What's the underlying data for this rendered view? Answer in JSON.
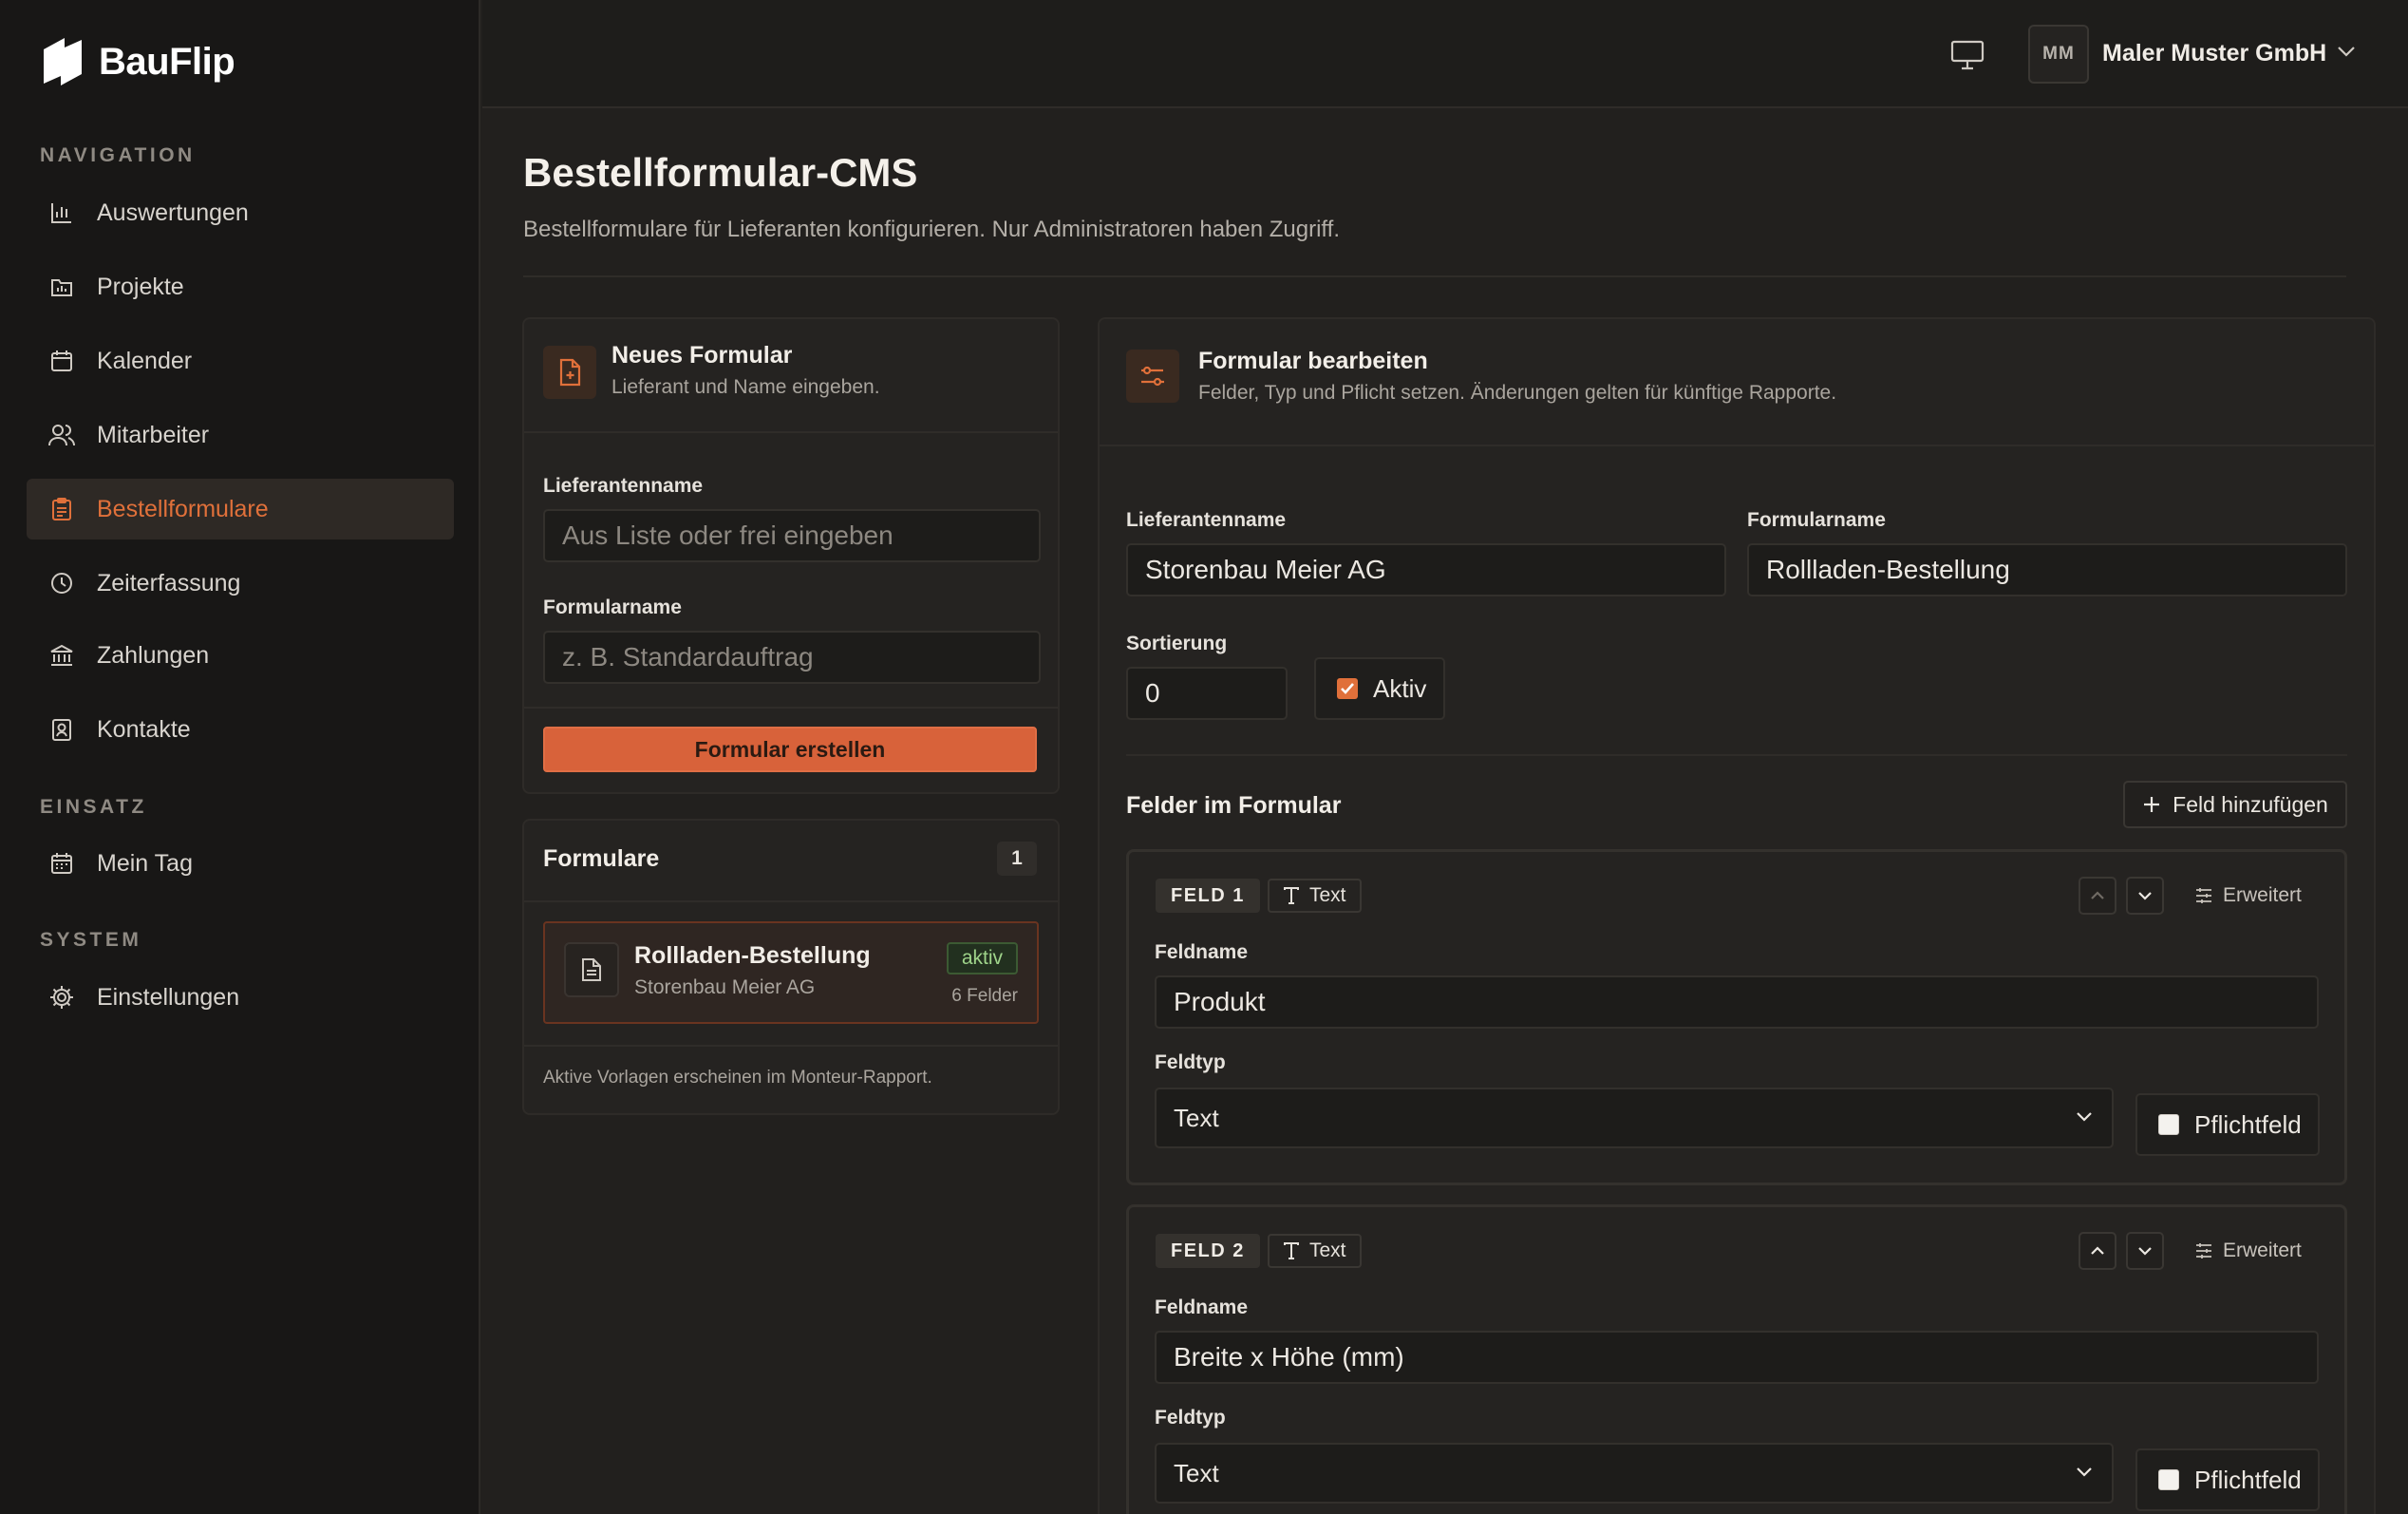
{
  "app": {
    "name": "BauFlip",
    "accent_color": "#e0703a",
    "background_color": "#22201e",
    "sidebar_color": "#181716"
  },
  "sidebar": {
    "sections": [
      {
        "label": "NAVIGATION"
      },
      {
        "label": "EINSATZ"
      },
      {
        "label": "SYSTEM"
      }
    ],
    "items": [
      {
        "label": "Auswertungen",
        "icon": "bar-chart-icon"
      },
      {
        "label": "Projekte",
        "icon": "folder-chart-icon"
      },
      {
        "label": "Kalender",
        "icon": "calendar-icon"
      },
      {
        "label": "Mitarbeiter",
        "icon": "users-icon"
      },
      {
        "label": "Bestellformulare",
        "icon": "clipboard-icon",
        "active": true
      },
      {
        "label": "Zeiterfassung",
        "icon": "clock-icon"
      },
      {
        "label": "Zahlungen",
        "icon": "bank-icon"
      },
      {
        "label": "Kontakte",
        "icon": "contact-book-icon"
      },
      {
        "label": "Mein Tag",
        "icon": "calendar-day-icon"
      },
      {
        "label": "Einstellungen",
        "icon": "gear-icon"
      }
    ]
  },
  "header": {
    "avatar_initials": "MM",
    "company_name": "Maler Muster GmbH"
  },
  "page": {
    "title": "Bestellformular-CMS",
    "subtitle": "Bestellformulare für Lieferanten konfigurieren. Nur Administratoren haben Zugriff."
  },
  "new_form": {
    "title": "Neues Formular",
    "subtitle": "Lieferant und Name eingeben.",
    "supplier_label": "Lieferantenname",
    "supplier_placeholder": "Aus Liste oder frei eingeben",
    "form_name_label": "Formularname",
    "form_name_placeholder": "z. B. Standardauftrag",
    "create_button": "Formular erstellen"
  },
  "forms_list": {
    "title": "Formulare",
    "count": "1",
    "items": [
      {
        "name": "Rollladen-Bestellung",
        "supplier": "Storenbau Meier AG",
        "status": "aktiv",
        "field_count": "6 Felder"
      }
    ],
    "footnote": "Aktive Vorlagen erscheinen im Monteur-Rapport."
  },
  "edit_form": {
    "title": "Formular bearbeiten",
    "subtitle": "Felder, Typ und Pflicht setzen. Änderungen gelten für künftige Rapporte.",
    "supplier_label": "Lieferantenname",
    "supplier_value": "Storenbau Meier AG",
    "form_name_label": "Formularname",
    "form_name_value": "Rollladen-Bestellung",
    "sort_label": "Sortierung",
    "sort_value": "0",
    "active_label": "Aktiv",
    "active_checked": true,
    "fields_title": "Felder im Formular",
    "add_field_button": "Feld hinzufügen",
    "fields": [
      {
        "badge": "FELD 1",
        "type_badge": "Text",
        "advanced_label": "Erweitert",
        "name_label": "Feldname",
        "name_value": "Produkt",
        "type_label": "Feldtyp",
        "type_value": "Text",
        "required_label": "Pflichtfeld",
        "required": false
      },
      {
        "badge": "FELD 2",
        "type_badge": "Text",
        "advanced_label": "Erweitert",
        "name_label": "Feldname",
        "name_value": "Breite x Höhe (mm)",
        "type_label": "Feldtyp",
        "type_value": "Text",
        "required_label": "Pflichtfeld",
        "required": false
      }
    ]
  }
}
